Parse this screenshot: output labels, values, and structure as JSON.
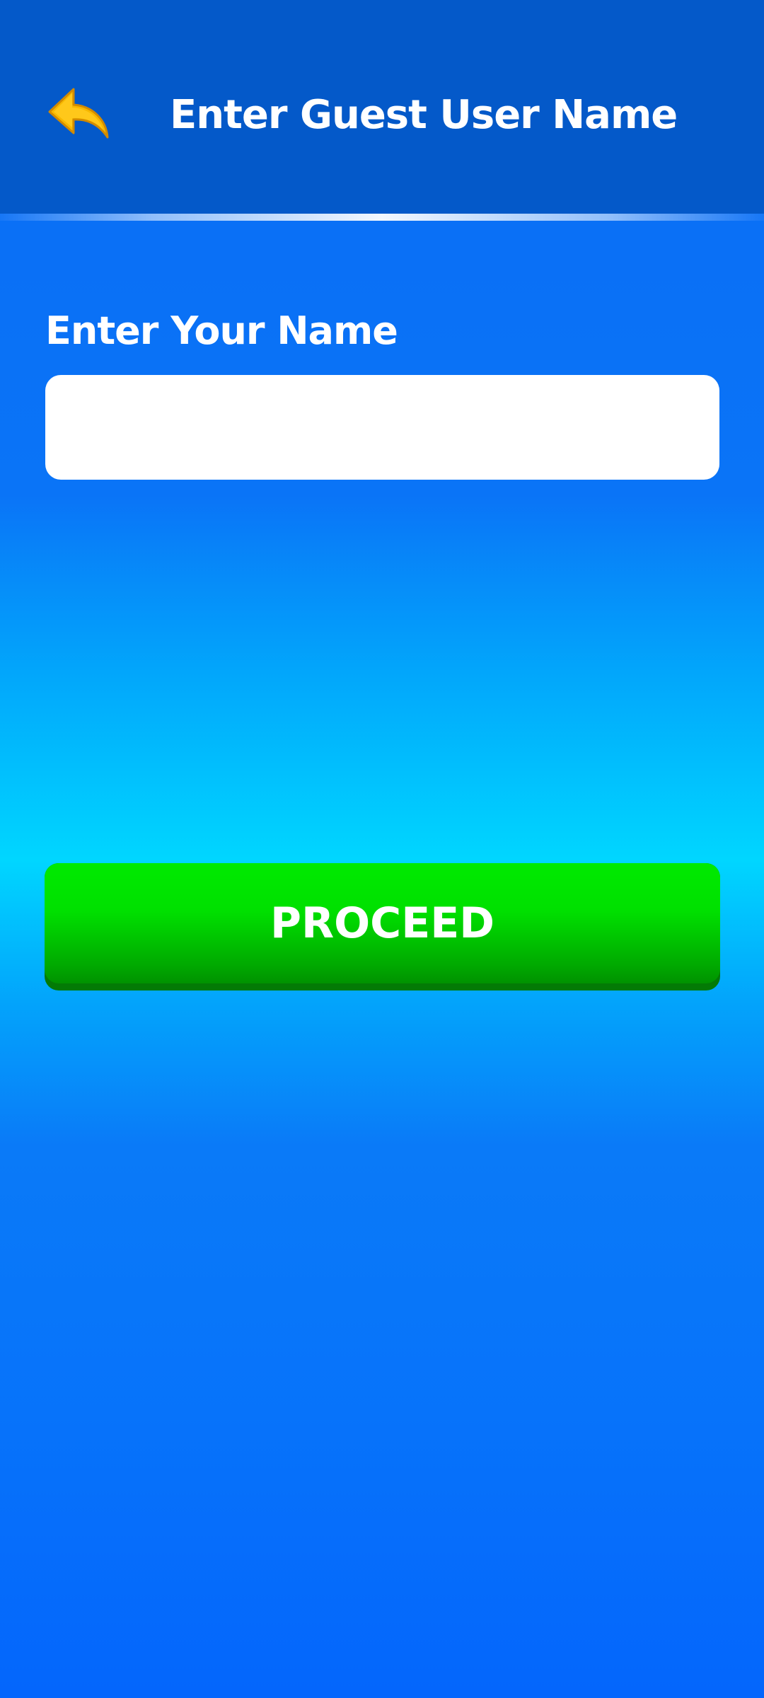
{
  "header": {
    "back_icon": "undo-arrow-icon",
    "title": "Enter Guest User Name"
  },
  "form": {
    "name_label": "Enter Your Name",
    "name_value": "",
    "name_placeholder": ""
  },
  "actions": {
    "proceed_label": "PROCEED"
  },
  "colors": {
    "header_bg": "#0459c9",
    "page_bg_top": "#0a6cf5",
    "page_bg_mid": "#00d6ff",
    "button_green": "#00e000",
    "back_icon": "#f7b800"
  }
}
